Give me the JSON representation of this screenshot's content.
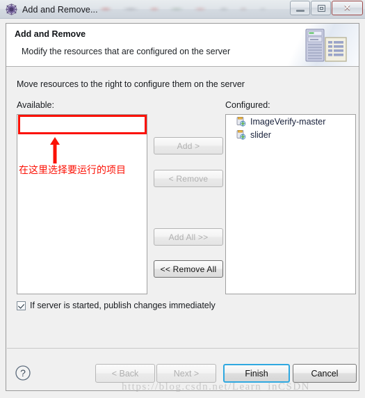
{
  "window": {
    "title": "Add and Remove...",
    "app_icon": "gear-icon",
    "controls": {
      "minimize": "minimize-icon",
      "maximize": "restore-icon",
      "close": "✕"
    }
  },
  "banner": {
    "title": "Add and Remove",
    "subtitle": "Modify the resources that are configured on the server",
    "art": "server-and-document-icon"
  },
  "content": {
    "intro": "Move resources to the right to configure them on the server",
    "available_label": "Available:",
    "configured_label": "Configured:",
    "available_items": [],
    "configured_items": [
      {
        "label": "ImageVerify-master",
        "icon": "project-module-icon"
      },
      {
        "label": "slider",
        "icon": "project-module-icon"
      }
    ]
  },
  "transfer_buttons": [
    {
      "label": "Add >",
      "enabled": false
    },
    {
      "label": "< Remove",
      "enabled": false
    },
    {
      "label": "Add All >>",
      "enabled": false
    },
    {
      "label": "<< Remove All",
      "enabled": true
    }
  ],
  "publish_option": {
    "label": "If server is started, publish changes immediately",
    "checked": true
  },
  "footer": {
    "help": "?",
    "back": "< Back",
    "next": "Next >",
    "finish": "Finish",
    "cancel": "Cancel"
  },
  "annotation": {
    "text": "在这里选择要运行的项目",
    "color": "#fb1206"
  },
  "watermark": "https://blog.csdn.net/Learn_inCSDN"
}
